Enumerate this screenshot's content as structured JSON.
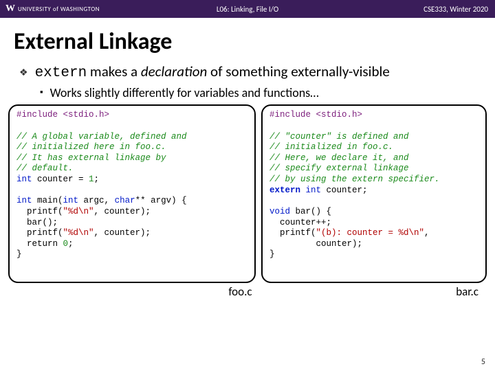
{
  "topbar": {
    "university": "UNIVERSITY of WASHINGTON",
    "lecture": "L06: Linking, File I/O",
    "course": "CSE333, Winter 2020"
  },
  "title": "External Linkage",
  "bullet1_pre": "extern",
  "bullet1_mid": " makes a ",
  "bullet1_em": "declaration",
  "bullet1_post": " of something externally-visible",
  "bullet2": "Works slightly differently for variables and functions…",
  "code_left": {
    "include": "#include <stdio.h>",
    "c1": "// A global variable, defined and",
    "c2": "// initialized here in foo.c.",
    "c3": "// It has external linkage by",
    "c4": "// default.",
    "decl_type": "int",
    "decl_rest": " counter = ",
    "decl_num": "1",
    "decl_end": ";",
    "main_sig1": "int",
    "main_sig2": " main(",
    "main_sig3": "int",
    "main_sig4": " argc, ",
    "main_sig5": "char",
    "main_sig6": "** argv) {",
    "p1a": "  printf(",
    "p1s": "\"%d\\n\"",
    "p1b": ", counter);",
    "barcall": "  bar();",
    "p2a": "  printf(",
    "p2s": "\"%d\\n\"",
    "p2b": ", counter);",
    "ret": "  return ",
    "ret0": "0",
    "retend": ";",
    "close": "}"
  },
  "code_right": {
    "include": "#include <stdio.h>",
    "c1": "// \"counter\" is defined and",
    "c2": "// initialized in foo.c.",
    "c3": "// Here, we declare it, and",
    "c4": "// specify external linkage",
    "c5": "// by using the extern specifier.",
    "ext_kw": "extern",
    "ext_sp": " ",
    "ext_type": "int",
    "ext_rest": " counter;",
    "bar_sig1": "void",
    "bar_sig2": " bar() {",
    "inc": "  counter++;",
    "p1a": "  printf(",
    "p1s": "\"(b): counter = %d\\n\"",
    "p1b": ",",
    "p2": "         counter);",
    "close": "}"
  },
  "file_left": "foo.c",
  "file_right": "bar.c",
  "pagenum": "5"
}
